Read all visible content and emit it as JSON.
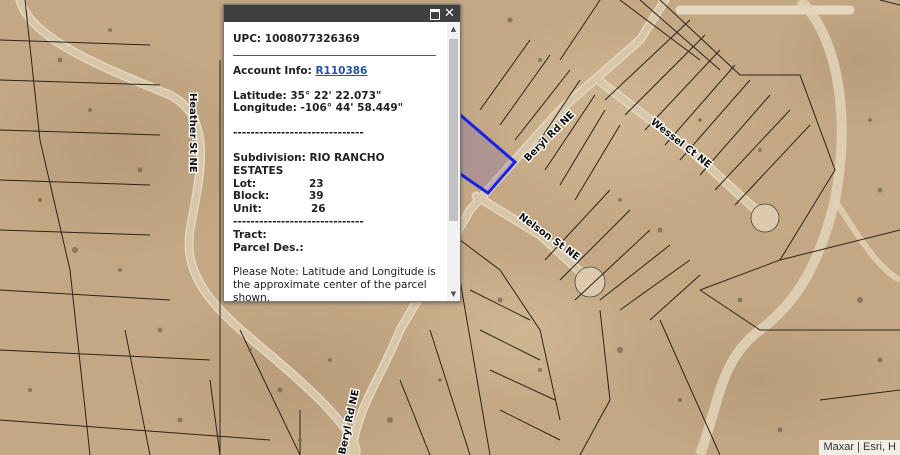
{
  "map": {
    "road_labels": [
      "Heather St NE",
      "Beryl Rd NE",
      "Wessel Ct NE",
      "Nelson St NE",
      "Beryl Rd NE"
    ],
    "selected_parcel_color": "#1a22e6",
    "attribution": "Maxar | Esri, H"
  },
  "popup": {
    "controls": {
      "maximize_icon": "maximize-icon",
      "close_icon": "close-icon",
      "close_glyph": "✕"
    },
    "upc_label": "UPC: 1008077326369",
    "account_label": "Account Info:",
    "account_link": "R110386",
    "latitude": "Latitude: 35° 22' 22.073\"",
    "longitude": "Longitude: -106° 44' 58.449\"",
    "dashes_1": "------------------------------",
    "subdivision_line1": "Subdivision: RIO RANCHO",
    "subdivision_line2": "ESTATES",
    "lot_label": "Lot:",
    "lot_value": "23",
    "block_label": "Block:",
    "block_value": "39",
    "unit_label": "Unit:",
    "unit_value": "26",
    "dashes_2": "------------------------------",
    "tract_label": "Tract:",
    "parcel_des_label": "Parcel Des.:",
    "note": "Please Note: Latitude and Longitude is the approximate center of the parcel shown."
  }
}
